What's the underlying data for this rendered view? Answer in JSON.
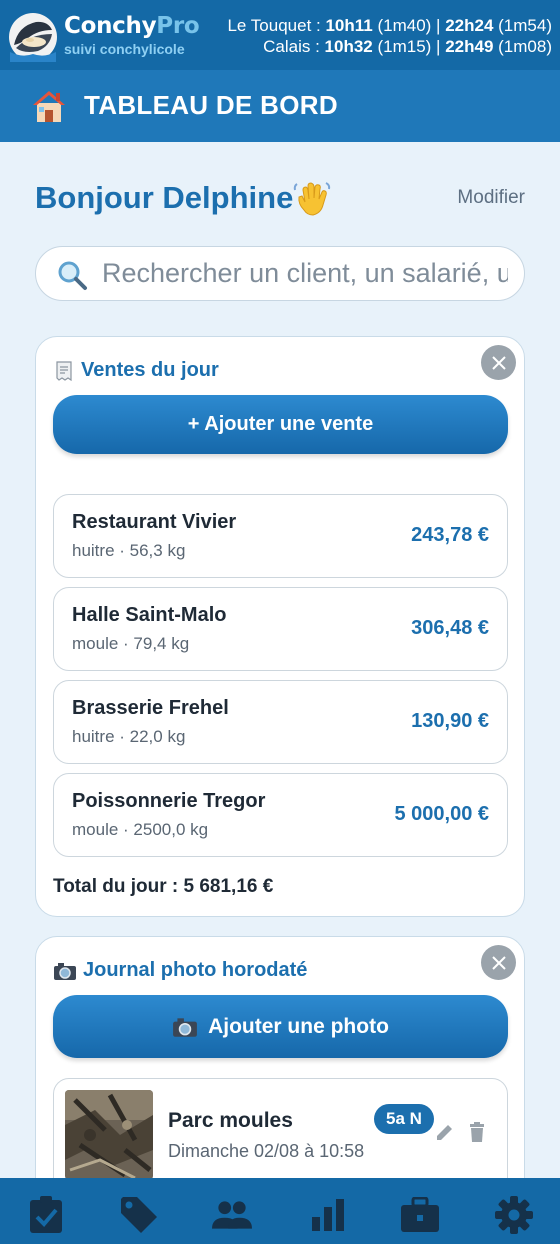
{
  "header": {
    "brand_name": "Conchy",
    "brand_pro": "Pro",
    "brand_sub": "suivi conchylicole",
    "tides": [
      {
        "place": "Le Touquet",
        "high1": "10h11",
        "dur1": "(1m40)",
        "high2": "22h24",
        "dur2": "(1m54)"
      },
      {
        "place": "Calais",
        "high1": "10h32",
        "dur1": "(1m15)",
        "high2": "22h49",
        "dur2": "(1m08)"
      }
    ]
  },
  "titlebar": {
    "title": "TABLEAU DE BORD",
    "icon": "house-icon"
  },
  "greeting": {
    "text": "Bonjour Delphine",
    "modify_label": "Modifier"
  },
  "search": {
    "placeholder": "Rechercher un client, un salarié, un lot…"
  },
  "ventes": {
    "title": "Ventes du jour",
    "add_label": "+ Ajouter une vente",
    "items": [
      {
        "name": "Restaurant Vivier",
        "detail": "huitre · 56,3 kg",
        "amount": "243,78 €"
      },
      {
        "name": "Halle Saint-Malo",
        "detail": "moule · 79,4 kg",
        "amount": "306,48 €"
      },
      {
        "name": "Brasserie Frehel",
        "detail": "huitre · 22,0 kg",
        "amount": "130,90 €"
      },
      {
        "name": "Poissonnerie Tregor",
        "detail": "moule · 2500,0 kg",
        "amount": "5 000,00 €"
      }
    ],
    "total": "Total du jour : 5 681,16 €"
  },
  "journal": {
    "title": "Journal photo horodaté",
    "add_label": "Ajouter une photo",
    "entries": [
      {
        "title": "Parc moules",
        "date": "Dimanche 02/08 à 10:58",
        "badge": "5a N"
      }
    ]
  },
  "bottom_nav": [
    "clipboard-check-icon",
    "tag-icon",
    "people-icon",
    "bar-chart-icon",
    "briefcase-icon",
    "settings-gear-icon"
  ],
  "colors": {
    "primary": "#1469a6",
    "accent": "#1c6fae",
    "background": "#e8f2fa"
  }
}
